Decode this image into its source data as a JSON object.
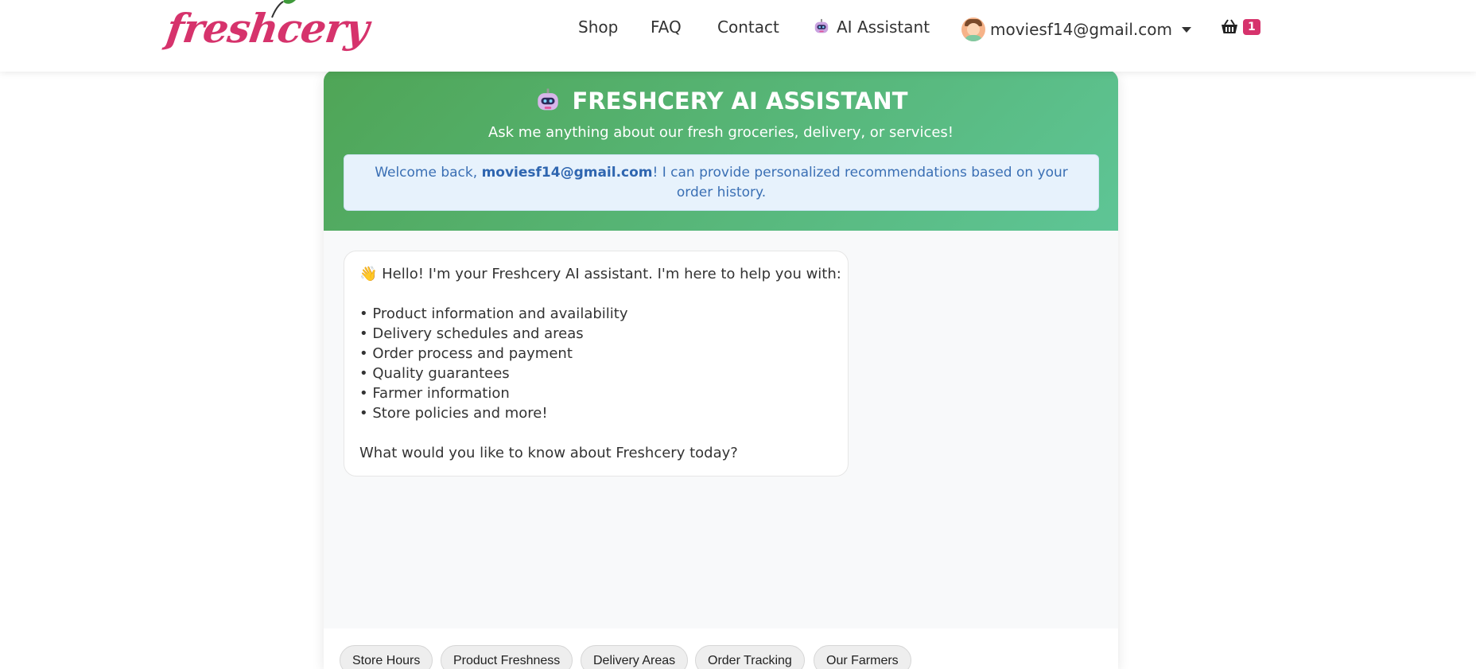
{
  "brand": {
    "logo_text": "freshcery",
    "color": "#d6336c"
  },
  "nav": {
    "links": [
      "Shop",
      "FAQ",
      "Contact"
    ],
    "ai_label": "AI Assistant",
    "user_email": "moviesf14@gmail.com",
    "cart_count": "1",
    "icons": {
      "ai": "robot-icon",
      "cart": "basket-icon",
      "user": "avatar"
    }
  },
  "chat": {
    "title": "FRESHCERY AI ASSISTANT",
    "subtitle": "Ask me anything about our fresh groceries, delivery, or services!",
    "welcome": {
      "prefix": "Welcome back, ",
      "email": "moviesf14@gmail.com",
      "suffix": "! I can provide personalized recommendations based on your order history."
    },
    "bot_message": {
      "greeting": "👋 Hello! I'm your Freshcery AI assistant. I'm here to help you with:",
      "items": [
        "• Product information and availability",
        "• Delivery schedules and areas",
        "• Order process and payment",
        "• Quality guarantees",
        "• Farmer information",
        "• Store policies and more!"
      ],
      "closing": "What would you like to know about Freshcery today?"
    },
    "quick_replies": [
      "Store Hours",
      "Product Freshness",
      "Delivery Areas",
      "Order Tracking",
      "Our Farmers"
    ]
  },
  "colors": {
    "header_gradient_start": "#4fa556",
    "header_gradient_end": "#5ec596",
    "welcome_bg": "#e7f2fc",
    "welcome_text": "#3a6fb4",
    "badge": "#d6336c"
  }
}
